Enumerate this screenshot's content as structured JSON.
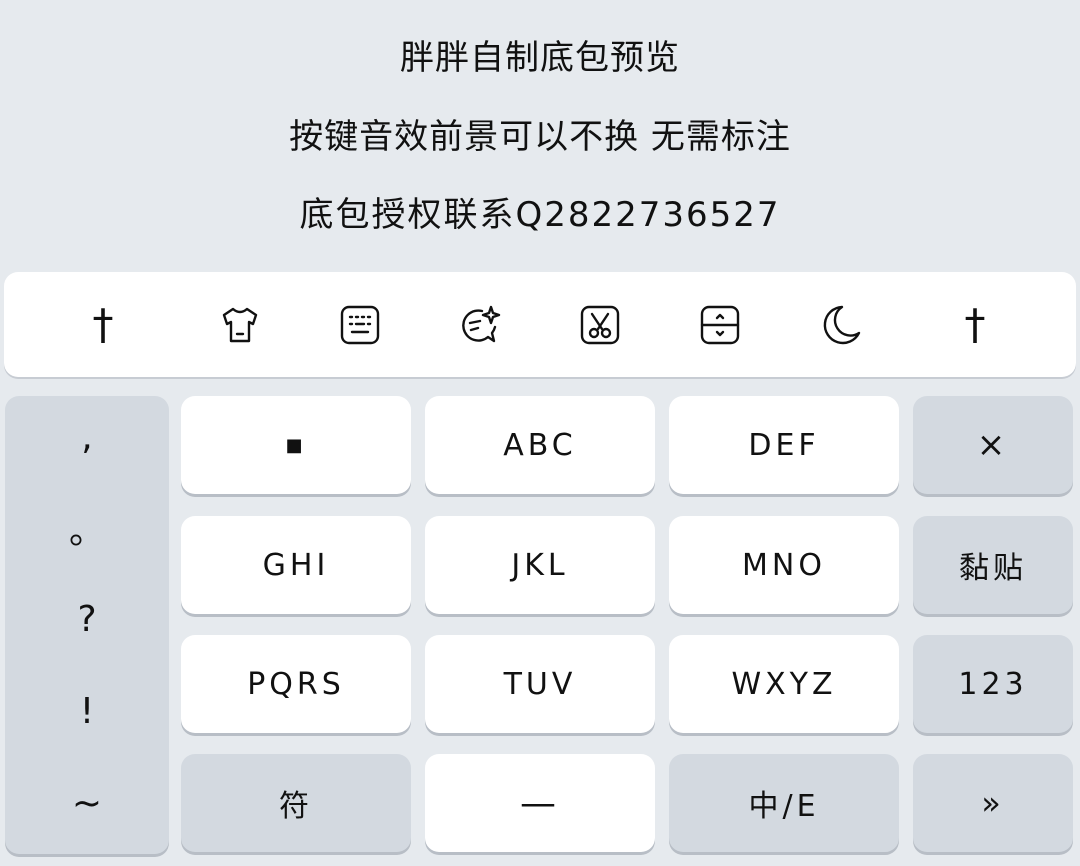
{
  "header": {
    "line1": "胖胖自制底包预览",
    "line2": "按键音效前景可以不换  无需标注",
    "line3": "底包授权联系Q2822736527"
  },
  "toolbar": {
    "left_symbol": "†",
    "right_symbol": "†",
    "icons": [
      "tshirt-icon",
      "keyboard-icon",
      "chat-sparkle-icon",
      "scissors-icon",
      "resize-icon",
      "moon-icon"
    ]
  },
  "punctuation": [
    ",",
    "。",
    "?",
    "!",
    "~"
  ],
  "keys": {
    "dot": "■",
    "abc": "ABC",
    "def": "DEF",
    "delete": "×",
    "ghi": "GHI",
    "jkl": "JKL",
    "mno": "MNO",
    "paste": "黏贴",
    "pqrs": "PQRS",
    "tuv": "TUV",
    "wxyz": "WXYZ",
    "num": "123",
    "symbol": "符",
    "space": "—",
    "lang": "中/E",
    "enter": "»"
  }
}
